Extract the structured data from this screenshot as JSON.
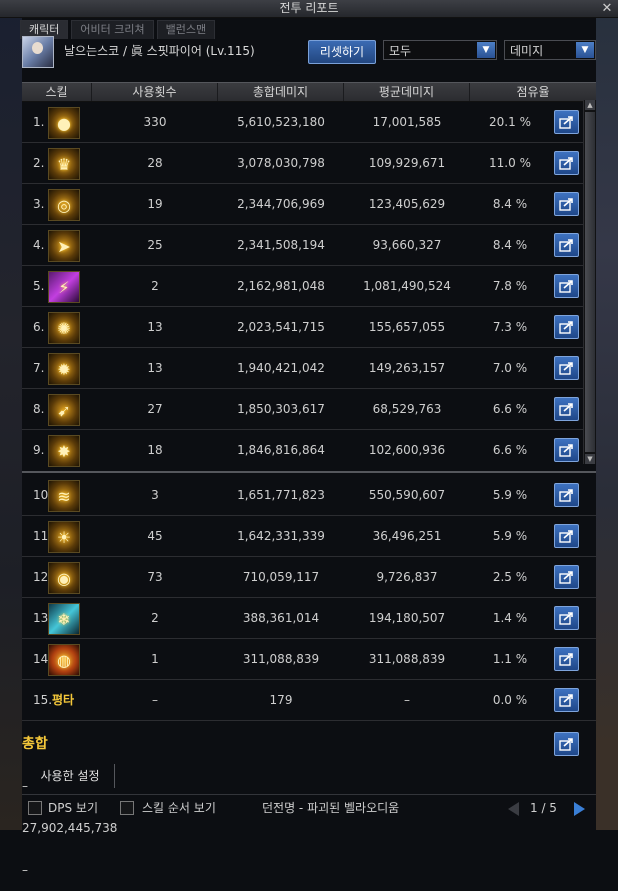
{
  "window": {
    "title": "전투 리포트"
  },
  "tabs": [
    {
      "label": "캐릭터",
      "active": true
    },
    {
      "label": "어비터 크리쳐",
      "active": false
    },
    {
      "label": "밸런스맨",
      "active": false
    }
  ],
  "character": {
    "name": "날으는스코 / 眞 스핏파이어 (Lv.115)"
  },
  "reset_label": "리셋하기",
  "filter1": "모두",
  "filter2": "데미지",
  "columns": [
    "스킬",
    "사용횟수",
    "총합데미지",
    "평균데미지",
    "점유율"
  ],
  "rows": [
    {
      "rank": "1.",
      "icon": "grenade-skill-icon",
      "count": "330",
      "total": "5,610,523,180",
      "avg": "17,001,585",
      "share": "20.1 %"
    },
    {
      "rank": "2.",
      "icon": "crown-blast-skill-icon",
      "count": "28",
      "total": "3,078,030,798",
      "avg": "109,929,671",
      "share": "11.0 %"
    },
    {
      "rank": "3.",
      "icon": "spiral-skill-icon",
      "count": "19",
      "total": "2,344,706,969",
      "avg": "123,405,629",
      "share": "8.4 %"
    },
    {
      "rank": "4.",
      "icon": "bullet-skill-icon",
      "count": "25",
      "total": "2,341,508,194",
      "avg": "93,660,327",
      "share": "8.4 %"
    },
    {
      "rank": "5.",
      "icon": "purple-strike-skill-icon",
      "count": "2",
      "total": "2,162,981,048",
      "avg": "1,081,490,524",
      "share": "7.8 %"
    },
    {
      "rank": "6.",
      "icon": "tree-burst-skill-icon",
      "count": "13",
      "total": "2,023,541,715",
      "avg": "155,657,055",
      "share": "7.3 %"
    },
    {
      "rank": "7.",
      "icon": "explosion-skill-icon",
      "count": "13",
      "total": "1,940,421,042",
      "avg": "149,263,157",
      "share": "7.0 %"
    },
    {
      "rank": "8.",
      "icon": "rocket-skill-icon",
      "count": "27",
      "total": "1,850,303,617",
      "avg": "68,529,763",
      "share": "6.6 %"
    },
    {
      "rank": "9.",
      "icon": "star-burst-skill-icon",
      "count": "18",
      "total": "1,846,816,864",
      "avg": "102,600,936",
      "share": "6.6 %"
    },
    {
      "rank": "10.",
      "icon": "barrage-skill-icon",
      "count": "3",
      "total": "1,651,771,823",
      "avg": "550,590,607",
      "share": "5.9 %"
    },
    {
      "rank": "11.",
      "icon": "ray-skill-icon",
      "count": "45",
      "total": "1,642,331,339",
      "avg": "36,496,251",
      "share": "5.9 %"
    },
    {
      "rank": "12.",
      "icon": "grenade-toss-skill-icon",
      "count": "73",
      "total": "710,059,117",
      "avg": "9,726,837",
      "share": "2.5 %"
    },
    {
      "rank": "13.",
      "icon": "ice-shard-skill-icon",
      "count": "2",
      "total": "388,361,014",
      "avg": "194,180,507",
      "share": "1.4 %"
    },
    {
      "rank": "14.",
      "icon": "eye-sigil-skill-icon",
      "count": "1",
      "total": "311,088,839",
      "avg": "311,088,839",
      "share": "1.1 %"
    },
    {
      "rank": "15.",
      "name": "평타",
      "count": "–",
      "total": "179",
      "avg": "–",
      "share": "0.0 %"
    }
  ],
  "total": {
    "label": "총합",
    "count": "–",
    "total": "27,902,445,738",
    "avg": "–"
  },
  "used_settings": "사용한 설정",
  "footer": {
    "dps_label": "DPS 보기",
    "skill_order_label": "스킬 순서 보기",
    "dungeon": "던전명 - 파괴된 벨라오디움",
    "page": "1 / 5"
  },
  "colors": {
    "accent_blue": "#2f5ea8",
    "gold": "#f5c83a"
  }
}
